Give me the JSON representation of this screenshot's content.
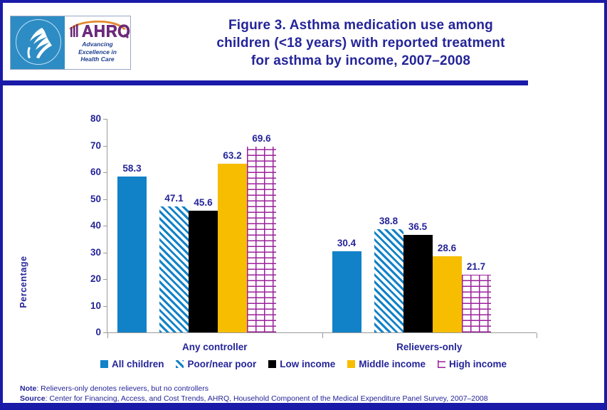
{
  "header": {
    "title": "Figure 3. Asthma medication use among children (<18 years) with reported treatment for asthma by income, 2007–2008",
    "title_line1": "Figure 3. Asthma medication use among",
    "title_line2": "children (<18 years) with reported treatment",
    "title_line3": "for asthma by income, 2007–2008",
    "logo": {
      "acronym": "AHRQ",
      "tagline_line1": "Advancing",
      "tagline_line2": "Excellence in",
      "tagline_line3": "Health Care",
      "seal_icon": "hhs-eagle-seal-icon"
    }
  },
  "footnotes": {
    "note_lead": "Note",
    "note_text": ": Relievers-only denotes relievers, but no controllers",
    "source_lead": "Source",
    "source_text": ": Center for Financing, Access, and Cost Trends, AHRQ,  Household Component of the Medical Expenditure Panel Survey,  2007–2008"
  },
  "colors": {
    "title_blue": "#242499",
    "rule_blue": "#1a1aa8",
    "border_blue": "#1a1aa8",
    "series_all_children": "#1282c8",
    "series_poor_near_poor": "#1282c8",
    "series_low_income": "#000000",
    "series_middle_income": "#f7bd00",
    "series_high_income": "#9b219b",
    "axis_gray": "#9a9a9a"
  },
  "chart_data": {
    "type": "bar",
    "title": "Figure 3. Asthma medication use among children (<18 years) with reported treatment for asthma by income, 2007–2008",
    "xlabel": "",
    "ylabel": "Percentage",
    "ylim": [
      0,
      80
    ],
    "yticks": [
      0,
      10,
      20,
      30,
      40,
      50,
      60,
      70,
      80
    ],
    "ytick_labels": [
      "0",
      "10",
      "20",
      "30",
      "40",
      "50",
      "60",
      "70",
      "80"
    ],
    "grid": false,
    "legend_position": "bottom",
    "categories": [
      "Any controller",
      "Relievers-only"
    ],
    "series": [
      {
        "name": "All children",
        "values": [
          58.3,
          30.4
        ],
        "labels": [
          "58.3",
          "30.4"
        ],
        "color": "#1282c8",
        "pattern": "solid"
      },
      {
        "name": "Poor/near poor",
        "values": [
          47.1,
          38.8
        ],
        "labels": [
          "47.1",
          "38.8"
        ],
        "color": "#1282c8",
        "pattern": "diagonal-stripe"
      },
      {
        "name": "Low income",
        "values": [
          45.6,
          36.5
        ],
        "labels": [
          "45.6",
          "36.5"
        ],
        "color": "#000000",
        "pattern": "solid"
      },
      {
        "name": "Middle income",
        "values": [
          63.2,
          28.6
        ],
        "labels": [
          "63.2",
          "28.6"
        ],
        "color": "#f7bd00",
        "pattern": "solid"
      },
      {
        "name": "High income",
        "values": [
          69.6,
          21.7
        ],
        "labels": [
          "69.6",
          "21.7"
        ],
        "color": "#9b219b",
        "pattern": "brick"
      }
    ]
  }
}
